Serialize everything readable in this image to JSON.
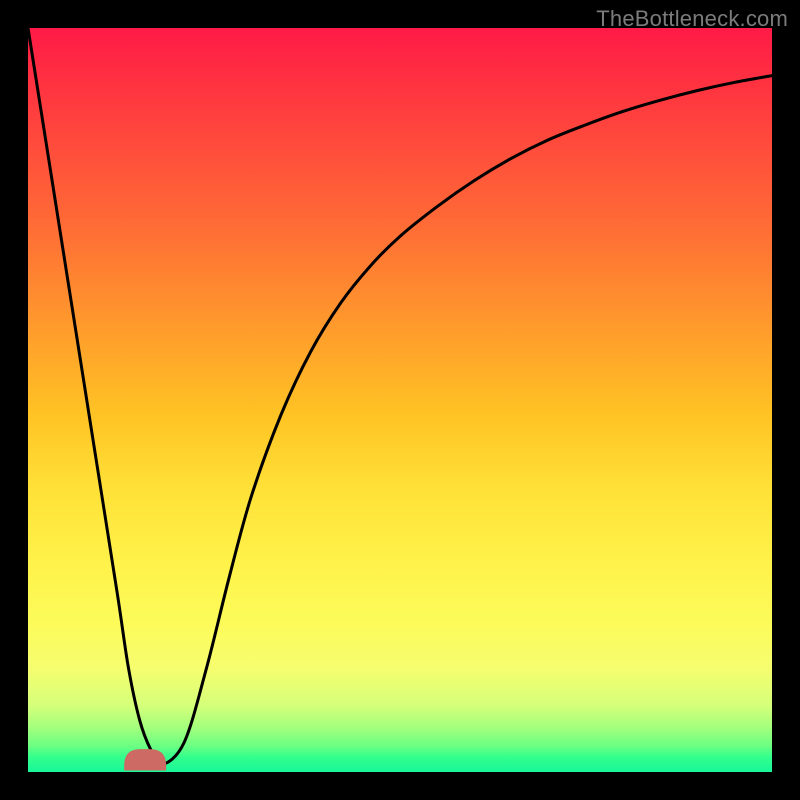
{
  "watermark": "TheBottleneck.com",
  "colors": {
    "curve": "#000000",
    "bump": "#cc6a63",
    "frame": "#000000"
  },
  "chart_data": {
    "type": "line",
    "title": "",
    "xlabel": "",
    "ylabel": "",
    "xlim": [
      0,
      100
    ],
    "ylim": [
      0,
      100
    ],
    "grid": false,
    "series": [
      {
        "name": "bottleneck-curve",
        "x": [
          0,
          3,
          6,
          9,
          12,
          13.5,
          15,
          16.5,
          18,
          21,
          24,
          27,
          30,
          34,
          38,
          42,
          46,
          50,
          55,
          60,
          65,
          70,
          75,
          80,
          85,
          90,
          95,
          100
        ],
        "y": [
          100,
          81,
          62,
          43,
          24,
          14,
          7,
          3,
          1,
          4,
          14,
          26,
          37,
          48,
          56.5,
          63,
          68,
          72,
          76,
          79.5,
          82.5,
          85,
          87,
          88.8,
          90.3,
          91.6,
          92.7,
          93.6
        ]
      }
    ],
    "annotations": [
      {
        "name": "valley-bump",
        "shape": "rounded-rect",
        "x_range": [
          13,
          18.5
        ],
        "y_range": [
          0,
          3
        ],
        "fill": "#cc6a63"
      }
    ]
  }
}
